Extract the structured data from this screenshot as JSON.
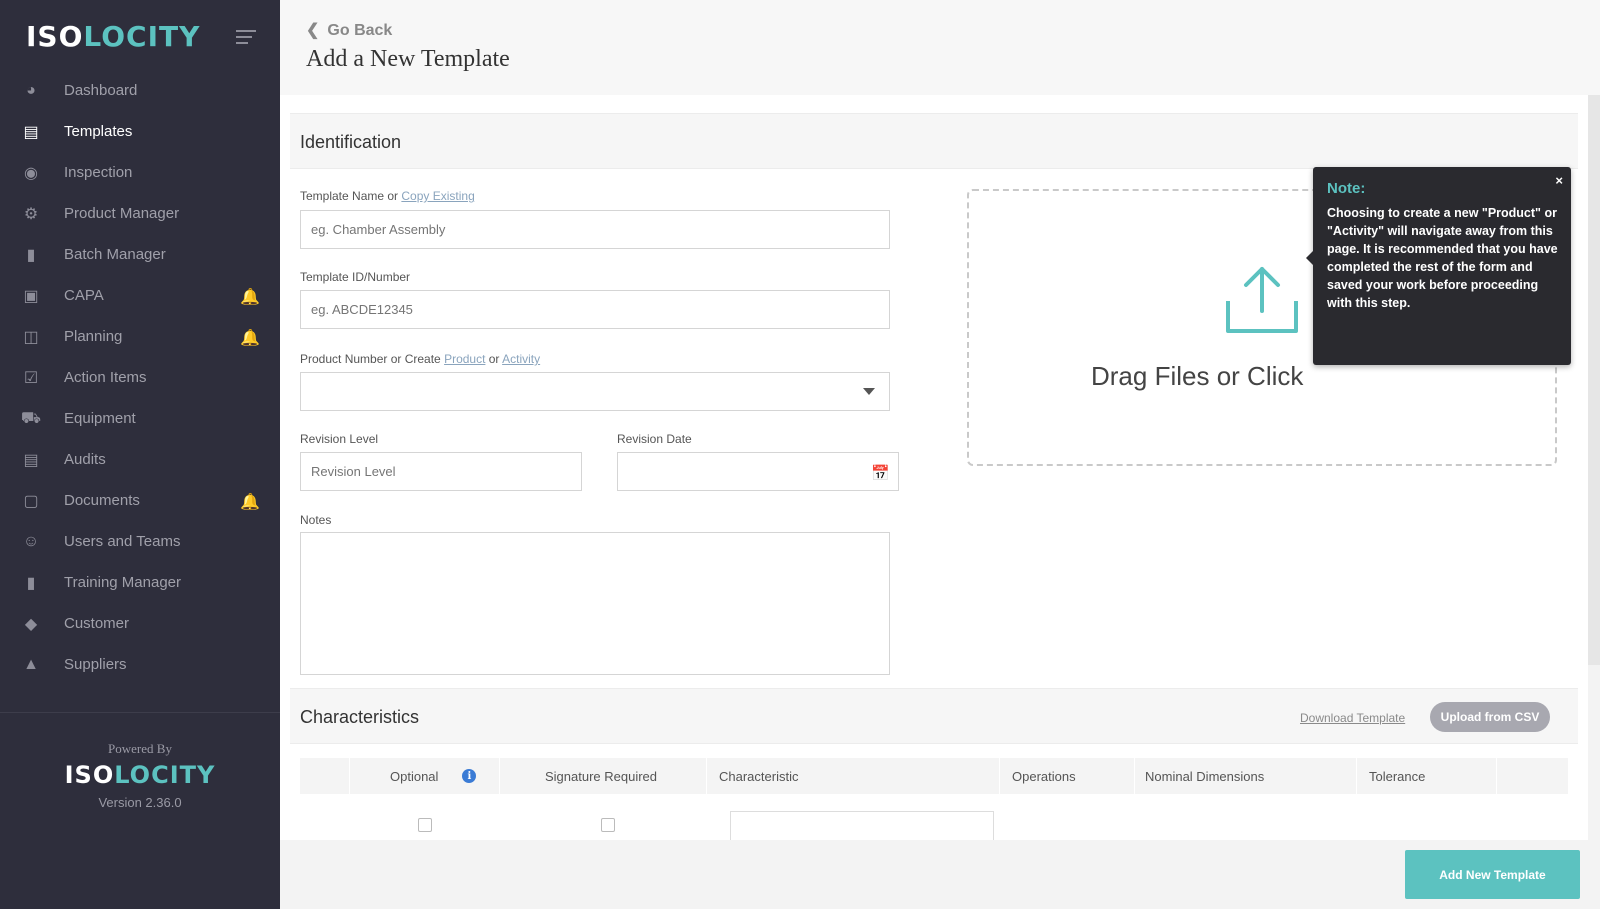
{
  "brand": {
    "logo_left": "ISO",
    "logo_right": "LOCITY",
    "accent": "#5cc2c0"
  },
  "sidebar": {
    "items": [
      {
        "label": "Dashboard",
        "icon": "dashboard-icon",
        "active": false,
        "bell": false
      },
      {
        "label": "Templates",
        "icon": "image-icon",
        "active": true,
        "bell": false
      },
      {
        "label": "Inspection",
        "icon": "target-icon",
        "active": false,
        "bell": false
      },
      {
        "label": "Product Manager",
        "icon": "gear-icon",
        "active": false,
        "bell": false
      },
      {
        "label": "Batch Manager",
        "icon": "barcode-icon",
        "active": false,
        "bell": false
      },
      {
        "label": "CAPA",
        "icon": "medkit-icon",
        "active": false,
        "bell": true
      },
      {
        "label": "Planning",
        "icon": "map-icon",
        "active": false,
        "bell": true
      },
      {
        "label": "Action Items",
        "icon": "checkbox-icon",
        "active": false,
        "bell": false
      },
      {
        "label": "Equipment",
        "icon": "truck-icon",
        "active": false,
        "bell": false
      },
      {
        "label": "Audits",
        "icon": "file-icon",
        "active": false,
        "bell": false
      },
      {
        "label": "Documents",
        "icon": "folder-icon",
        "active": false,
        "bell": true
      },
      {
        "label": "Users and Teams",
        "icon": "users-icon",
        "active": false,
        "bell": false
      },
      {
        "label": "Training Manager",
        "icon": "book-icon",
        "active": false,
        "bell": false
      },
      {
        "label": "Customer",
        "icon": "tag-icon",
        "active": false,
        "bell": false
      },
      {
        "label": "Suppliers",
        "icon": "supplier-icon",
        "active": false,
        "bell": false
      }
    ],
    "powered_by": "Powered By",
    "version": "Version 2.36.0"
  },
  "header": {
    "go_back": "Go Back",
    "title": "Add a New Template"
  },
  "identification": {
    "section_title": "Identification",
    "template_name_label": "Template Name or ",
    "copy_existing": "Copy Existing",
    "template_name_placeholder": "eg. Chamber Assembly",
    "template_id_label": "Template ID/Number",
    "template_id_placeholder": "eg. ABCDE12345",
    "product_label_prefix": "Product Number or Create ",
    "product_link": "Product",
    "or_text": " or ",
    "activity_link": "Activity",
    "revision_level_label": "Revision Level",
    "revision_level_placeholder": "Revision Level",
    "revision_date_label": "Revision Date",
    "notes_label": "Notes"
  },
  "dropzone": {
    "text": "Drag Files or Click"
  },
  "tooltip": {
    "title": "Note:",
    "close": "×",
    "body": "Choosing to create a new \"Product\" or \"Activity\" will navigate away from this page. It is recommended that you have completed the rest of the form and saved your work before proceeding with this step."
  },
  "characteristics": {
    "section_title": "Characteristics",
    "download_template": "Download Template",
    "upload_csv": "Upload from CSV",
    "columns": [
      "Optional",
      "Signature Required",
      "Characteristic",
      "Operations",
      "Nominal Dimensions",
      "Tolerance"
    ],
    "info_icon": "i"
  },
  "footer": {
    "add_button": "Add New Template"
  }
}
